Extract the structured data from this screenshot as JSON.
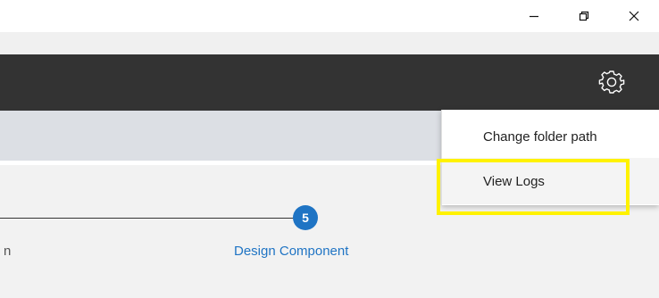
{
  "window": {
    "controls": [
      {
        "name": "minimize",
        "icon": "minimize-icon"
      },
      {
        "name": "restore",
        "icon": "restore-icon"
      },
      {
        "name": "close",
        "icon": "close-icon"
      }
    ]
  },
  "header": {
    "settings_icon": "gear-icon",
    "background_color": "#333333"
  },
  "settings_menu": {
    "items": [
      {
        "label": "Change folder path"
      },
      {
        "label": "View Logs"
      }
    ],
    "highlight_color": "#fff200"
  },
  "stepper": {
    "previous_step_label": "n",
    "active_step": {
      "number": "5",
      "label": "Design Component"
    },
    "accent_color": "#1f74c4"
  }
}
